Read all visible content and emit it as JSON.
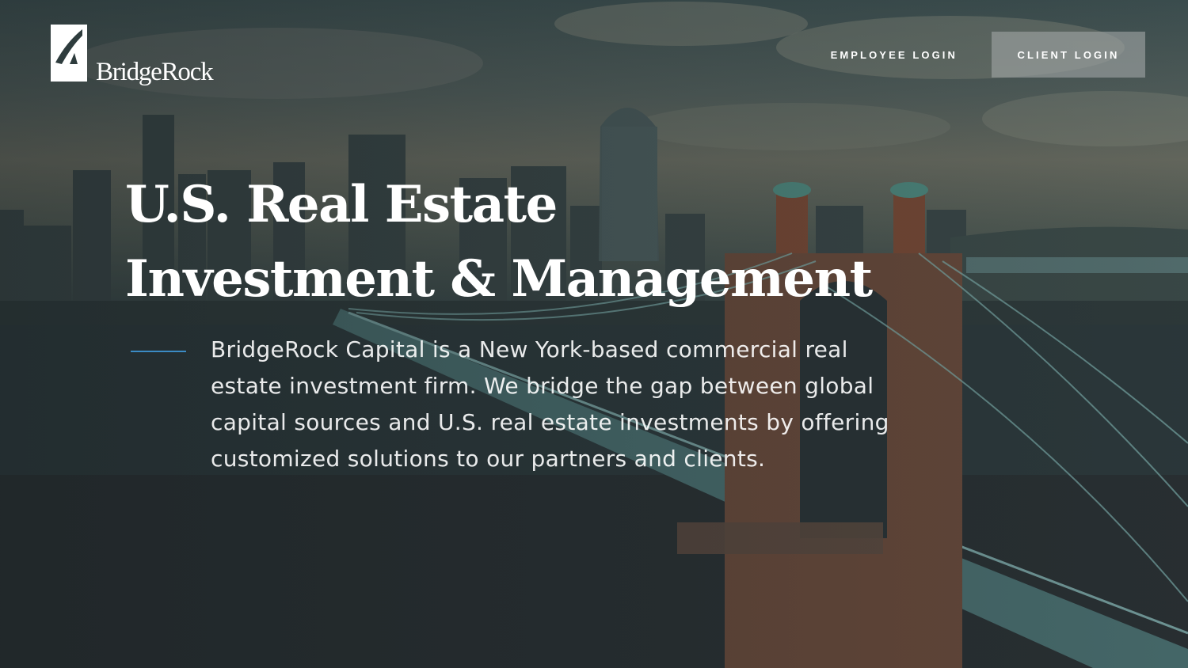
{
  "brand": {
    "name": "BridgeRock"
  },
  "nav": {
    "employee_login": "EMPLOYEE LOGIN",
    "client_login": "CLIENT LOGIN"
  },
  "hero": {
    "headline_line1": "U.S. Real Estate",
    "headline_line2": "Investment & Management",
    "description": "BridgeRock Capital is a New York-based commercial real estate investment firm. We bridge the gap between global capital sources and U.S. real estate investments by offering customized solutions to our partners and clients."
  },
  "colors": {
    "accent_line": "#3b8bc4",
    "button_bg": "#a0a5a5",
    "text": "#ffffff"
  },
  "icons": {
    "logo_mark": "bridgerock-logo-mark-icon"
  }
}
